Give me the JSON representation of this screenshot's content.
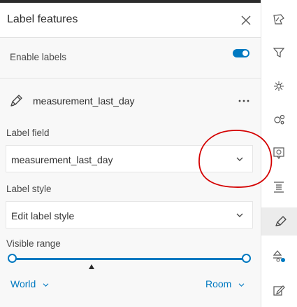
{
  "panel": {
    "title": "Label features",
    "enable_labels": {
      "label": "Enable labels",
      "on": true
    },
    "field_name": "measurement_last_day",
    "label_field": {
      "section": "Label field",
      "value": "measurement_last_day"
    },
    "label_style": {
      "section": "Label style",
      "value": "Edit label style"
    },
    "visible_range": {
      "section": "Visible range",
      "min_label": "World",
      "max_label": "Room"
    }
  },
  "rail": {
    "buttons": [
      {
        "name": "map-shape-icon"
      },
      {
        "name": "filter-icon"
      },
      {
        "name": "effects-sparkle-icon"
      },
      {
        "name": "cluster-icon"
      },
      {
        "name": "popup-icon"
      },
      {
        "name": "fields-list-icon"
      },
      {
        "name": "label-pencil-icon",
        "active": true
      },
      {
        "name": "styles-icon"
      },
      {
        "name": "edit-icon"
      }
    ]
  },
  "colors": {
    "accent": "#0079c1",
    "annotation": "#d40000"
  }
}
